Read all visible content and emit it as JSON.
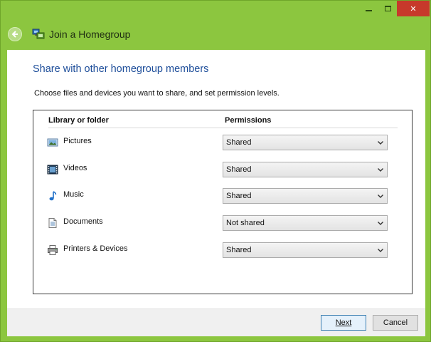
{
  "window": {
    "title": "Join a Homegroup",
    "accent": "#8cc63f"
  },
  "caption_buttons": {
    "close_glyph": "✕"
  },
  "main": {
    "heading": "Share with other homegroup members",
    "description": "Choose files and devices you want to share, and set permission levels.",
    "columns": {
      "library": "Library or folder",
      "permissions": "Permissions"
    },
    "rows": [
      {
        "label": "Pictures",
        "permission": "Shared",
        "icon": "pictures-icon"
      },
      {
        "label": "Videos",
        "permission": "Shared",
        "icon": "videos-icon"
      },
      {
        "label": "Music",
        "permission": "Shared",
        "icon": "music-icon"
      },
      {
        "label": "Documents",
        "permission": "Not shared",
        "icon": "documents-icon"
      },
      {
        "label": "Printers & Devices",
        "permission": "Shared",
        "icon": "printer-icon"
      }
    ]
  },
  "footer": {
    "next_label": "Next",
    "cancel_label": "Cancel"
  }
}
